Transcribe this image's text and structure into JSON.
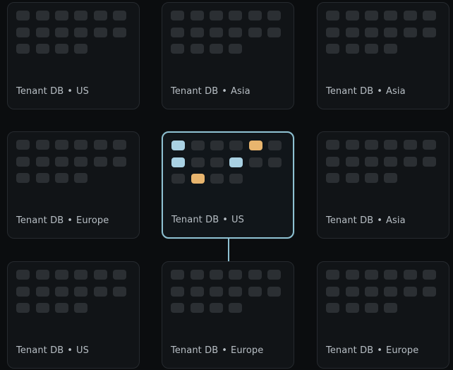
{
  "cards": [
    {
      "name": "Tenant DB",
      "region": "US",
      "tiles": [
        "g",
        "g",
        "g",
        "g",
        "g",
        "g",
        "g",
        "g",
        "g",
        "g",
        "g",
        "g",
        "g",
        "g",
        "g",
        "g"
      ]
    },
    {
      "name": "Tenant DB",
      "region": "Asia",
      "tiles": [
        "g",
        "g",
        "g",
        "g",
        "g",
        "g",
        "g",
        "g",
        "g",
        "g",
        "g",
        "g",
        "g",
        "g",
        "g",
        "g"
      ]
    },
    {
      "name": "Tenant DB",
      "region": "Asia",
      "tiles": [
        "g",
        "g",
        "g",
        "g",
        "g",
        "g",
        "g",
        "g",
        "g",
        "g",
        "g",
        "g",
        "g",
        "g",
        "g",
        "g"
      ]
    },
    {
      "name": "Tenant DB",
      "region": "Europe",
      "tiles": [
        "g",
        "g",
        "g",
        "g",
        "g",
        "g",
        "g",
        "g",
        "g",
        "g",
        "g",
        "g",
        "g",
        "g",
        "g",
        "g"
      ]
    },
    {
      "name": "Tenant DB",
      "region": "US",
      "active": true,
      "tiles": [
        "blue",
        "g",
        "g",
        "g",
        "orange",
        "g",
        "blue",
        "g",
        "g",
        "blue",
        "g",
        "g",
        "g",
        "orange",
        "g",
        "g"
      ]
    },
    {
      "name": "Tenant DB",
      "region": "Asia",
      "tiles": [
        "g",
        "g",
        "g",
        "g",
        "g",
        "g",
        "g",
        "g",
        "g",
        "g",
        "g",
        "g",
        "g",
        "g",
        "g",
        "g"
      ]
    },
    {
      "name": "Tenant DB",
      "region": "US",
      "tiles": [
        "g",
        "g",
        "g",
        "g",
        "g",
        "g",
        "g",
        "g",
        "g",
        "g",
        "g",
        "g",
        "g",
        "g",
        "g",
        "g"
      ]
    },
    {
      "name": "Tenant DB",
      "region": "Europe",
      "tiles": [
        "g",
        "g",
        "g",
        "g",
        "g",
        "g",
        "g",
        "g",
        "g",
        "g",
        "g",
        "g",
        "g",
        "g",
        "g",
        "g"
      ]
    },
    {
      "name": "Tenant DB",
      "region": "Europe",
      "tiles": [
        "g",
        "g",
        "g",
        "g",
        "g",
        "g",
        "g",
        "g",
        "g",
        "g",
        "g",
        "g",
        "g",
        "g",
        "g",
        "g"
      ]
    }
  ],
  "separator": "•",
  "colors": {
    "background": "#0b0d0f",
    "card": "#111417",
    "tile": "#2b2f33",
    "active_border": "#8ec1d2",
    "blue": "#a9d1e3",
    "orange": "#e8b56e",
    "label": "#b7bec4"
  }
}
